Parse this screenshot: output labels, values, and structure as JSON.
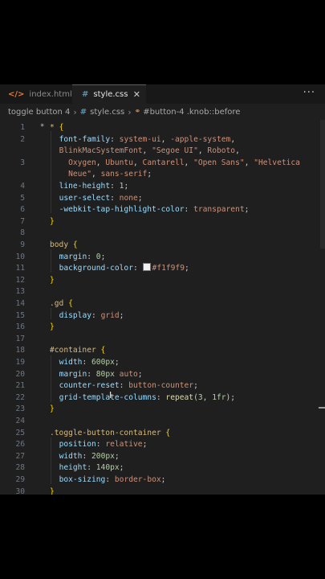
{
  "tabs": [
    {
      "label": "index.html",
      "icon": "html-icon",
      "active": false
    },
    {
      "label": "style.css",
      "icon": "css-icon",
      "active": true
    }
  ],
  "more_actions": "···",
  "close_glyph": "✕",
  "breadcrumb": {
    "folder": "toggle button 4",
    "file": "style.css",
    "symbol": "#button-4 .knob::before"
  },
  "code_lines": [
    {
      "n": "1",
      "html": "<span style='color:#d7ba7d'>*</span> <span style='color:#ffd700'>{</span>"
    },
    {
      "n": "2",
      "html": "  <span style='color:#9cdcfe'>font-family</span>: <span style='color:#ce9178'>system-ui</span>, <span style='color:#ce9178'>-apple-system</span>,"
    },
    {
      "n": "",
      "html": "  <span style='color:#ce9178'>BlinkMacSystemFont</span>, <span style='color:#ce9178'>\"Segoe UI\"</span>, <span style='color:#ce9178'>Roboto</span>,"
    },
    {
      "n": "3",
      "html": "    <span style='color:#ce9178'>Oxygen</span>, <span style='color:#ce9178'>Ubuntu</span>, <span style='color:#ce9178'>Cantarell</span>, <span style='color:#ce9178'>\"Open Sans\"</span>, <span style='color:#ce9178'>\"Helvetica</span>"
    },
    {
      "n": "",
      "html": "    <span style='color:#ce9178'>Neue\"</span>, <span style='color:#ce9178'>sans-serif</span>;"
    },
    {
      "n": "4",
      "html": "  <span style='color:#9cdcfe'>line-height</span>: <span style='color:#b5cea8'>1</span>;"
    },
    {
      "n": "5",
      "html": "  <span style='color:#9cdcfe'>user-select</span>: <span style='color:#ce9178'>none</span>;"
    },
    {
      "n": "6",
      "html": "  <span style='color:#9cdcfe'>-webkit-tap-highlight-color</span>: <span style='color:#ce9178'>transparent</span>;"
    },
    {
      "n": "7",
      "html": "<span style='color:#ffd700'>}</span>"
    },
    {
      "n": "8",
      "html": ""
    },
    {
      "n": "9",
      "html": "<span style='color:#d7ba7d'>body</span> <span style='color:#ffd700'>{</span>"
    },
    {
      "n": "10",
      "html": "  <span style='color:#9cdcfe'>margin</span>: <span style='color:#b5cea8'>0</span>;"
    },
    {
      "n": "11",
      "html": "  <span style='color:#9cdcfe'>background-color</span>: <span class='swatch'></span><span style='color:#ce9178'>#f1f9f9</span>;"
    },
    {
      "n": "12",
      "html": "<span style='color:#ffd700'>}</span>"
    },
    {
      "n": "13",
      "html": ""
    },
    {
      "n": "14",
      "html": "<span style='color:#d7ba7d'>.gd</span> <span style='color:#ffd700'>{</span>"
    },
    {
      "n": "15",
      "html": "  <span style='color:#9cdcfe'>display</span>: <span style='color:#ce9178'>grid</span>;"
    },
    {
      "n": "16",
      "html": "<span style='color:#ffd700'>}</span>"
    },
    {
      "n": "17",
      "html": ""
    },
    {
      "n": "18",
      "html": "<span style='color:#d7ba7d'>#container</span> <span style='color:#ffd700'>{</span>"
    },
    {
      "n": "19",
      "html": "  <span style='color:#9cdcfe'>width</span>: <span style='color:#b5cea8'>600px</span>;"
    },
    {
      "n": "20",
      "html": "  <span style='color:#9cdcfe'>margin</span>: <span style='color:#b5cea8'>80px</span> <span style='color:#ce9178'>auto</span>;"
    },
    {
      "n": "21",
      "html": "  <span style='color:#9cdcfe'>counter-reset</span>: <span style='color:#ce9178'>button-counter</span>;"
    },
    {
      "n": "22",
      "html": "  <span style='color:#9cdcfe'>grid-template-columns</span>: <span style='color:#dcdcaa'>repeat</span>(<span style='color:#b5cea8'>3</span>, <span style='color:#b5cea8'>1fr</span>);"
    },
    {
      "n": "23",
      "html": "<span style='color:#ffd700'>}</span>"
    },
    {
      "n": "24",
      "html": ""
    },
    {
      "n": "25",
      "html": "<span style='color:#d7ba7d'>.toggle-button-container</span> <span style='color:#ffd700'>{</span>"
    },
    {
      "n": "26",
      "html": "  <span style='color:#9cdcfe'>position</span>: <span style='color:#ce9178'>relative</span>;"
    },
    {
      "n": "27",
      "html": "  <span style='color:#9cdcfe'>width</span>: <span style='color:#b5cea8'>200px</span>;"
    },
    {
      "n": "28",
      "html": "  <span style='color:#9cdcfe'>height</span>: <span style='color:#b5cea8'>140px</span>;"
    },
    {
      "n": "29",
      "html": "  <span style='color:#9cdcfe'>box-sizing</span>: <span style='color:#ce9178'>border-box</span>;"
    },
    {
      "n": "30",
      "html": "<span style='color:#ffd700'>}</span>"
    }
  ],
  "colors": {
    "editor_bg": "#1f1f1f",
    "tabbar_bg": "#181818",
    "accent": "#0078d4",
    "selector": "#d7ba7d",
    "property": "#9cdcfe",
    "string_value": "#ce9178",
    "number_value": "#b5cea8"
  }
}
